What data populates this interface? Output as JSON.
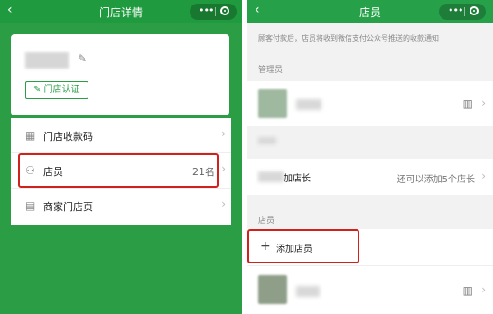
{
  "left": {
    "title": "门店详情",
    "back_icon": "‹",
    "capsule_dots": "•••",
    "edit_icon": "✎",
    "cert_label": "✎ 门店认证",
    "menu": [
      {
        "icon": "▦",
        "label": "门店收款码",
        "count": "",
        "arrow": "›"
      },
      {
        "icon": "⚇",
        "label": "店员",
        "count": "21名",
        "arrow": "›"
      },
      {
        "icon": "▤",
        "label": "商家门店页",
        "count": "",
        "arrow": "›"
      }
    ]
  },
  "right": {
    "title": "店员",
    "back_icon": "‹",
    "capsule_dots": "•••",
    "notice": "顾客付款后，店员将收到微信支付公众号推送的收款通知",
    "section_admin": "管理员",
    "qr_icon": "▥",
    "arrow": "›",
    "add_manager_label": "加店长",
    "add_manager_hint": "还可以添加5个店长",
    "section_staff": "店员",
    "add_staff_icon": "+",
    "add_staff_label": "添加店员"
  },
  "colors": {
    "wechat_green": "#2a9d45",
    "highlight_red": "#d0211c"
  }
}
